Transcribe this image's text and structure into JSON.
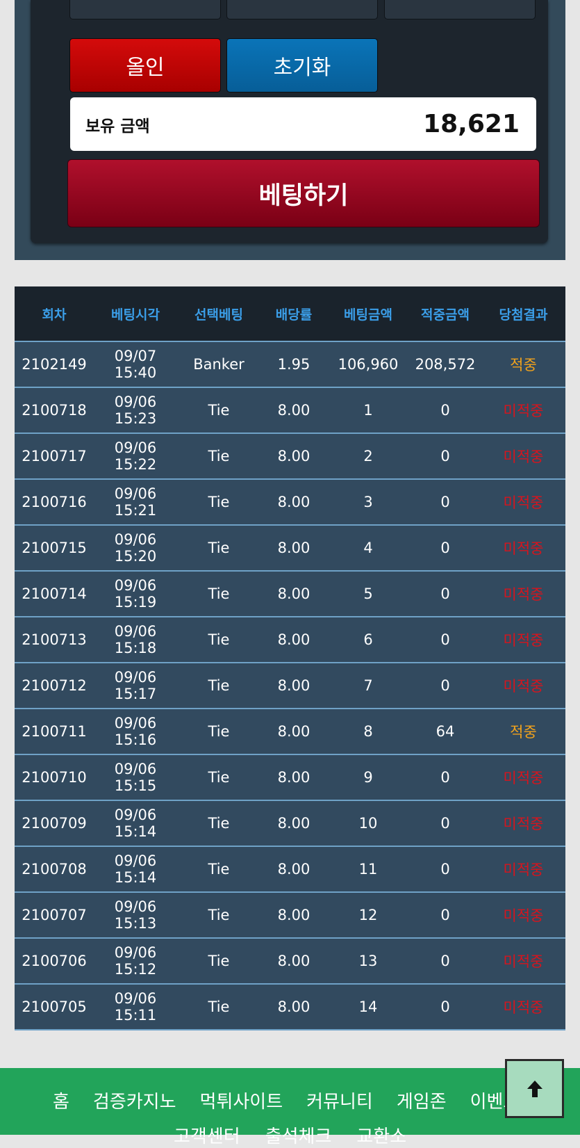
{
  "controls": {
    "allin_label": "올인",
    "reset_label": "초기화",
    "balance_label": "보유 금액",
    "balance_value": "18,621",
    "bet_label": "베팅하기"
  },
  "table": {
    "headers": [
      "회차",
      "베팅시각",
      "선택베팅",
      "배당률",
      "베팅금액",
      "적중금액",
      "당첨결과"
    ],
    "rows": [
      {
        "round": "2102149",
        "time": "09/07 15:40",
        "pick": "Banker",
        "odds": "1.95",
        "bet": "106,960",
        "payout": "208,572",
        "result": "적중",
        "status": "win"
      },
      {
        "round": "2100718",
        "time": "09/06 15:23",
        "pick": "Tie",
        "odds": "8.00",
        "bet": "1",
        "payout": "0",
        "result": "미적중",
        "status": "lose"
      },
      {
        "round": "2100717",
        "time": "09/06 15:22",
        "pick": "Tie",
        "odds": "8.00",
        "bet": "2",
        "payout": "0",
        "result": "미적중",
        "status": "lose"
      },
      {
        "round": "2100716",
        "time": "09/06 15:21",
        "pick": "Tie",
        "odds": "8.00",
        "bet": "3",
        "payout": "0",
        "result": "미적중",
        "status": "lose"
      },
      {
        "round": "2100715",
        "time": "09/06 15:20",
        "pick": "Tie",
        "odds": "8.00",
        "bet": "4",
        "payout": "0",
        "result": "미적중",
        "status": "lose"
      },
      {
        "round": "2100714",
        "time": "09/06 15:19",
        "pick": "Tie",
        "odds": "8.00",
        "bet": "5",
        "payout": "0",
        "result": "미적중",
        "status": "lose"
      },
      {
        "round": "2100713",
        "time": "09/06 15:18",
        "pick": "Tie",
        "odds": "8.00",
        "bet": "6",
        "payout": "0",
        "result": "미적중",
        "status": "lose"
      },
      {
        "round": "2100712",
        "time": "09/06 15:17",
        "pick": "Tie",
        "odds": "8.00",
        "bet": "7",
        "payout": "0",
        "result": "미적중",
        "status": "lose"
      },
      {
        "round": "2100711",
        "time": "09/06 15:16",
        "pick": "Tie",
        "odds": "8.00",
        "bet": "8",
        "payout": "64",
        "result": "적중",
        "status": "win"
      },
      {
        "round": "2100710",
        "time": "09/06 15:15",
        "pick": "Tie",
        "odds": "8.00",
        "bet": "9",
        "payout": "0",
        "result": "미적중",
        "status": "lose"
      },
      {
        "round": "2100709",
        "time": "09/06 15:14",
        "pick": "Tie",
        "odds": "8.00",
        "bet": "10",
        "payout": "0",
        "result": "미적중",
        "status": "lose"
      },
      {
        "round": "2100708",
        "time": "09/06 15:14",
        "pick": "Tie",
        "odds": "8.00",
        "bet": "11",
        "payout": "0",
        "result": "미적중",
        "status": "lose"
      },
      {
        "round": "2100707",
        "time": "09/06 15:13",
        "pick": "Tie",
        "odds": "8.00",
        "bet": "12",
        "payout": "0",
        "result": "미적중",
        "status": "lose"
      },
      {
        "round": "2100706",
        "time": "09/06 15:12",
        "pick": "Tie",
        "odds": "8.00",
        "bet": "13",
        "payout": "0",
        "result": "미적중",
        "status": "lose"
      },
      {
        "round": "2100705",
        "time": "09/06 15:11",
        "pick": "Tie",
        "odds": "8.00",
        "bet": "14",
        "payout": "0",
        "result": "미적중",
        "status": "lose"
      }
    ]
  },
  "footer": {
    "nav": [
      "홈",
      "검증카지노",
      "먹튀사이트",
      "커뮤니티",
      "게임존",
      "이벤트"
    ],
    "nav2": [
      "고객센터",
      "출석체크",
      "교환소"
    ]
  },
  "scroll_top": {
    "icon": "arrow-up-icon"
  },
  "colors": {
    "win": "#f2a31c",
    "lose": "#d8141d",
    "header_text": "#3b9ee8",
    "footer_bg": "#22a45a"
  }
}
